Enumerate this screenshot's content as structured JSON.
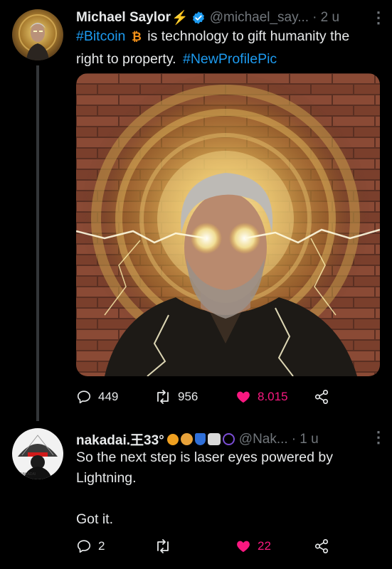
{
  "tweet1": {
    "display_name": "Michael Saylor",
    "name_emoji": "⚡",
    "handle": "@michael_say...",
    "time": "· 2 u",
    "more_label": "⋮",
    "text_line1_hashtag": "#Bitcoin",
    "text_line1_rest": " is technology to gift humanity the",
    "text_line2": "right to property.",
    "text_line2_hashtag": "#NewProfilePic",
    "stats": {
      "replies": "449",
      "retweets": "956",
      "likes": "8.015"
    }
  },
  "tweet2": {
    "display_name": "nakadai.王33°",
    "handle": "@Nak...",
    "time": "· 1 u",
    "more_label": "⋮",
    "text_line1": "So the next step is laser eyes powered by",
    "text_line2": "Lightning.",
    "text_line3": "Got it.",
    "stats": {
      "replies": "2",
      "retweets": "",
      "likes": "22"
    }
  },
  "colors": {
    "background": "#000000",
    "text": "#e7e9ea",
    "muted": "#71767b",
    "link": "#1d9bf0",
    "like": "#f91880",
    "verified": "#1d9bf0",
    "bitcoin": "#f7931a"
  },
  "icons": [
    "reply-icon",
    "retweet-icon",
    "like-icon",
    "share-icon",
    "verified-badge-icon",
    "bitcoin-icon",
    "more-icon"
  ]
}
